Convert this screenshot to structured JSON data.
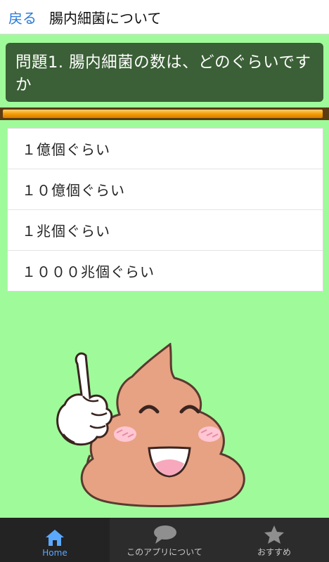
{
  "header": {
    "back_label": "戻る",
    "title": "腸内細菌について"
  },
  "question": {
    "text": "問題1. 腸内細菌の数は、どのぐらいですか"
  },
  "progress": {
    "fraction": 0.99
  },
  "answers": [
    {
      "label": "１億個ぐらい"
    },
    {
      "label": "１０億個ぐらい"
    },
    {
      "label": "１兆個ぐらい"
    },
    {
      "label": "１０００兆個ぐらい"
    }
  ],
  "bottom_nav": [
    {
      "label": "Home",
      "icon": "home-icon",
      "active": true
    },
    {
      "label": "このアプリについて",
      "icon": "speech-bubble-icon",
      "active": false
    },
    {
      "label": "おすすめ",
      "icon": "star-icon",
      "active": false
    }
  ],
  "colors": {
    "background": "#9ffb9a",
    "question_bg": "#3b5f36",
    "progress_fill": "#f19a00",
    "accent_blue": "#2a7ad8"
  }
}
